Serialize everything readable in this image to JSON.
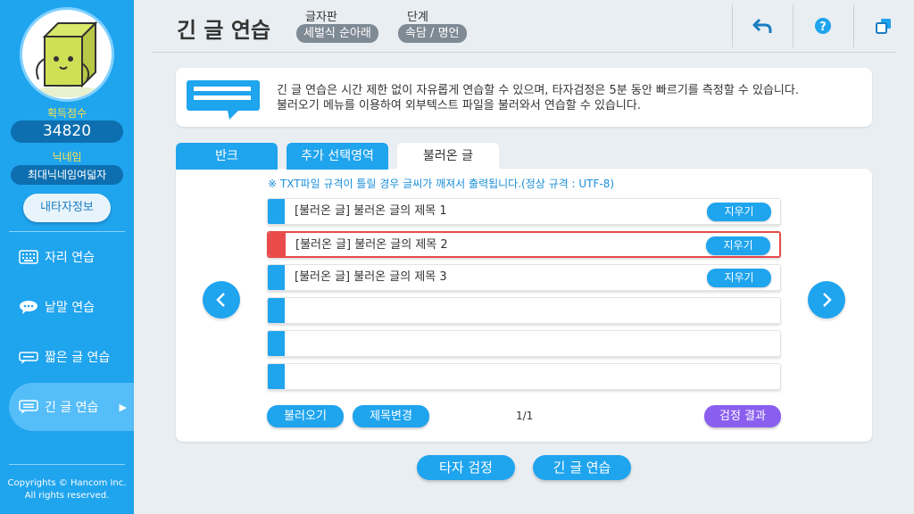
{
  "sidebar": {
    "score_label": "획득점수",
    "score": "34820",
    "nickname_label": "닉네임",
    "nickname": "최대닉네임여덟자",
    "myinfo_button": "내타자정보",
    "menu": [
      {
        "label": "자리 연습",
        "icon": "keyboard-icon"
      },
      {
        "label": "낱말 연습",
        "icon": "speech-bubble-icon"
      },
      {
        "label": "짧은 글 연습",
        "icon": "short-text-icon"
      },
      {
        "label": "긴 글 연습",
        "icon": "long-text-icon",
        "active": true
      }
    ],
    "copyright_line1": "Copyrights © Hancom Inc.",
    "copyright_line2": "All rights reserved."
  },
  "header": {
    "title": "긴 글 연습",
    "keyboard_label": "글자판",
    "keyboard_value": "세벌식 순아래",
    "level_label": "단계",
    "level_value": "속담 / 명언",
    "buttons": [
      "back-icon",
      "help-icon",
      "window-icon"
    ]
  },
  "info": {
    "line1": "긴 글 연습은 시간 제한 없이 자유롭게 연습할 수 있으며, 타자검정은 5분 동안 빠르기를 측정할 수 있습니다.",
    "line2": "불러오기 메뉴를 이용하여 외부텍스트 파일을 불러와서 연습할 수 있습니다."
  },
  "tabs": [
    {
      "label": "반크",
      "active": false
    },
    {
      "label": "추가 선택영역",
      "active": false
    },
    {
      "label": "불러온 글",
      "active": true
    }
  ],
  "notice": "※ TXT파일 규격이 틀릴 경우 글씨가 깨져서 출력됩니다.(정상 규격 : UTF-8)",
  "rows": [
    {
      "text": "[불러온 글] 불러온 글의 제목 1",
      "delete": "지우기"
    },
    {
      "text": "[불러온 글] 불러온 글의 제목 2",
      "delete": "지우기",
      "selected": true
    },
    {
      "text": "[불러온 글] 불러온 글의 제목 3",
      "delete": "지우기"
    },
    {
      "text": "",
      "delete": ""
    },
    {
      "text": "",
      "delete": ""
    },
    {
      "text": "",
      "delete": ""
    }
  ],
  "actions": {
    "load": "불러오기",
    "rename": "제목변경",
    "page": "1/1",
    "result": "검정 결과"
  },
  "bottom": {
    "test": "타자 검정",
    "practice": "긴 글 연습"
  },
  "colors": {
    "primary": "#1fa4ee",
    "selected": "#e94b4b",
    "result_button": "#8a5ff0",
    "sidebar": "#1fa4ee"
  }
}
